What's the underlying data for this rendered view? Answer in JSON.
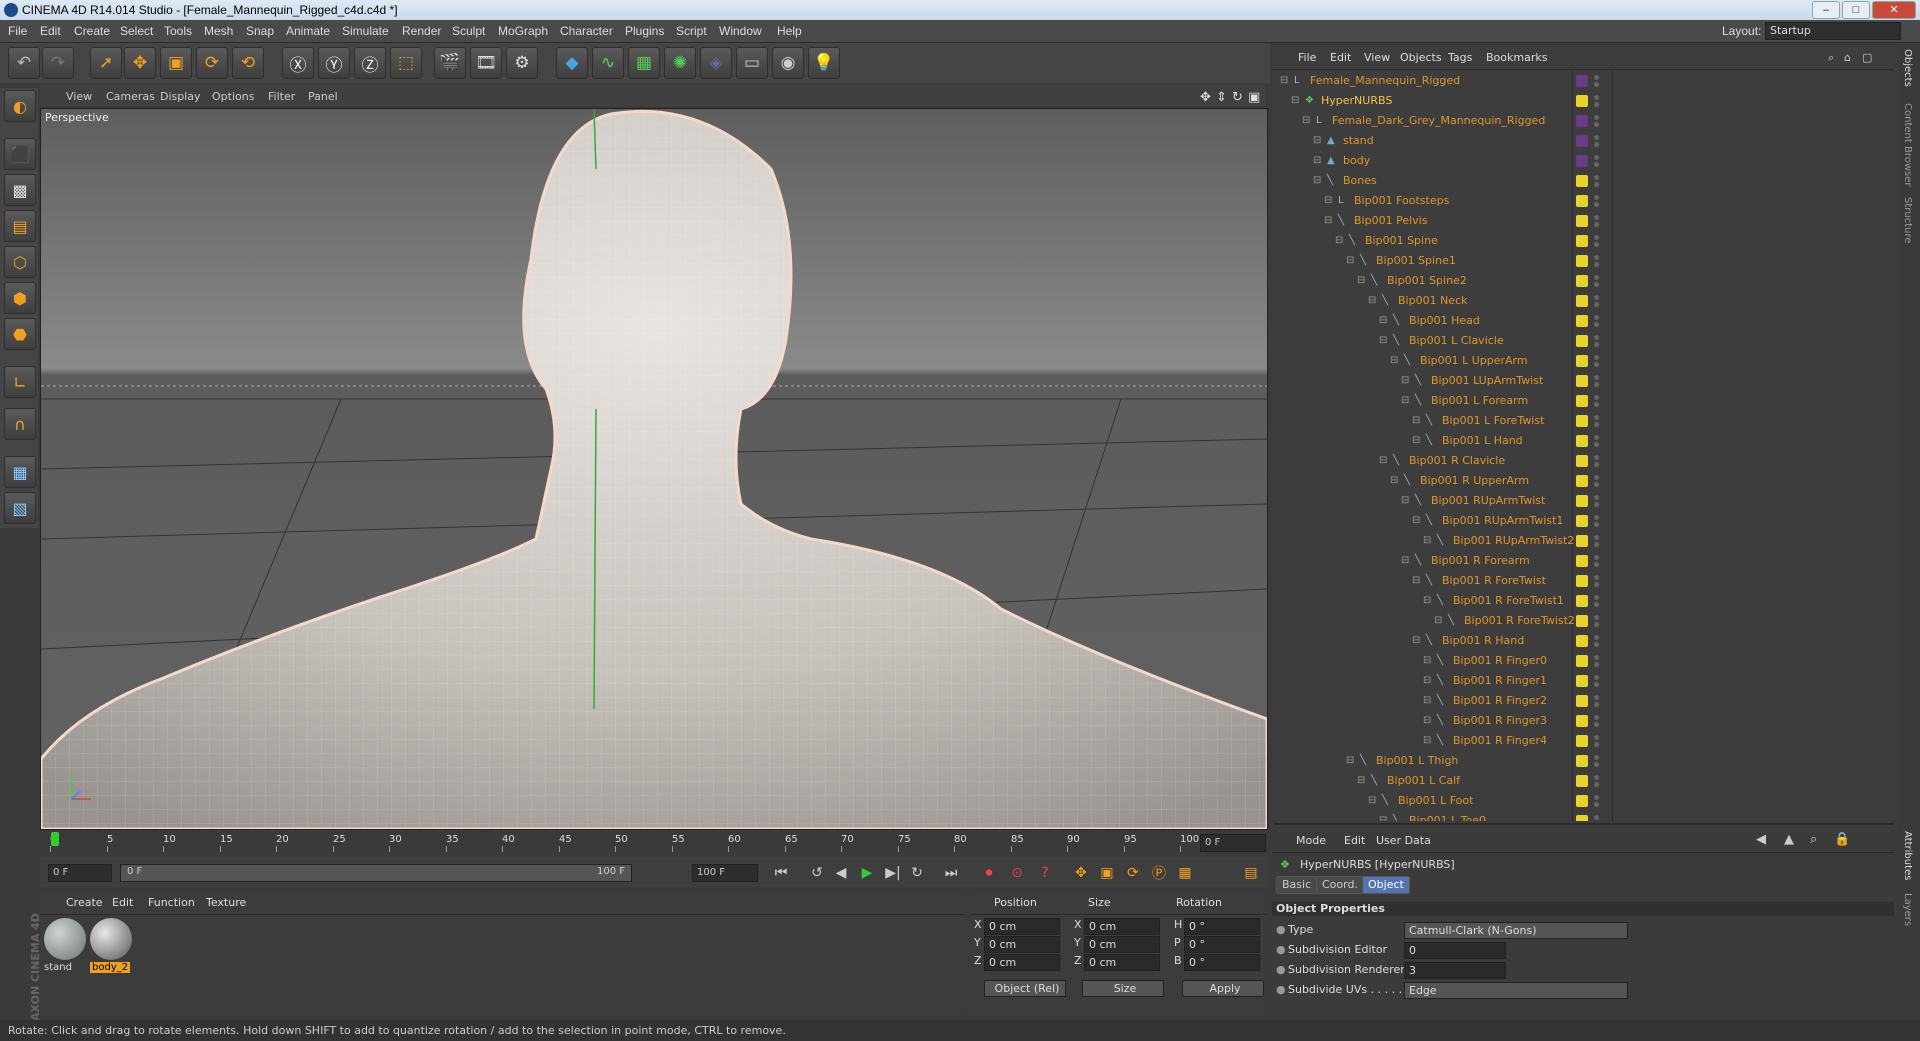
{
  "window": {
    "title": "CINEMA 4D R14.014 Studio - [Female_Mannequin_Rigged_c4d.c4d *]",
    "layout_label": "Layout:",
    "layout_value": "Startup"
  },
  "menubar": [
    "File",
    "Edit",
    "Create",
    "Select",
    "Tools",
    "Mesh",
    "Snap",
    "Animate",
    "Simulate",
    "Render",
    "Sculpt",
    "MoGraph",
    "Character",
    "Plugins",
    "Script",
    "Window",
    "Help"
  ],
  "viewport": {
    "menu": [
      "View",
      "Cameras",
      "Display",
      "Options",
      "Filter",
      "Panel"
    ],
    "label": "Perspective"
  },
  "timeline": {
    "ticks": [
      "0",
      "5",
      "10",
      "15",
      "20",
      "25",
      "30",
      "35",
      "40",
      "45",
      "50",
      "55",
      "60",
      "65",
      "70",
      "75",
      "80",
      "85",
      "90",
      "95",
      "100"
    ],
    "frame_display": "0 F"
  },
  "transport": {
    "start": "0 F",
    "range_start": "0 F",
    "range_end": "100 F",
    "end": "100 F"
  },
  "material_manager": {
    "menu": [
      "Create",
      "Edit",
      "Function",
      "Texture"
    ],
    "materials": [
      {
        "name": "stand",
        "selected": false
      },
      {
        "name": "body_2",
        "selected": true
      }
    ]
  },
  "coord_manager": {
    "headers": [
      "Position",
      "Size",
      "Rotation"
    ],
    "rows": [
      {
        "pos_label": "X",
        "pos": "0 cm",
        "size_label": "X",
        "size": "0 cm",
        "rot_label": "H",
        "rot": "0 °"
      },
      {
        "pos_label": "Y",
        "pos": "0 cm",
        "size_label": "Y",
        "size": "0 cm",
        "rot_label": "P",
        "rot": "0 °"
      },
      {
        "pos_label": "Z",
        "pos": "0 cm",
        "size_label": "Z",
        "size": "0 cm",
        "rot_label": "B",
        "rot": "0 °"
      }
    ],
    "mode": "Object (Rel)",
    "size_mode": "Size",
    "apply": "Apply"
  },
  "object_manager": {
    "menu": [
      "File",
      "Edit",
      "View",
      "Objects",
      "Tags",
      "Bookmarks"
    ],
    "objects": [
      {
        "name": "Female_Mannequin_Rigged",
        "depth": 0,
        "icon": "null"
      },
      {
        "name": "HyperNURBS",
        "depth": 1,
        "icon": "nurbs"
      },
      {
        "name": "Female_Dark_Grey_Mannequin_Rigged",
        "depth": 2,
        "icon": "null"
      },
      {
        "name": "stand",
        "depth": 3,
        "icon": "mesh"
      },
      {
        "name": "body",
        "depth": 3,
        "icon": "mesh"
      },
      {
        "name": "Bones",
        "depth": 3,
        "icon": "bone"
      },
      {
        "name": "Bip001 Footsteps",
        "depth": 4,
        "icon": "null"
      },
      {
        "name": "Bip001 Pelvis",
        "depth": 4,
        "icon": "bone"
      },
      {
        "name": "Bip001 Spine",
        "depth": 5,
        "icon": "bone"
      },
      {
        "name": "Bip001 Spine1",
        "depth": 6,
        "icon": "bone"
      },
      {
        "name": "Bip001 Spine2",
        "depth": 7,
        "icon": "bone"
      },
      {
        "name": "Bip001 Neck",
        "depth": 8,
        "icon": "bone"
      },
      {
        "name": "Bip001 Head",
        "depth": 9,
        "icon": "bone"
      },
      {
        "name": "Bip001 L Clavicle",
        "depth": 9,
        "icon": "bone"
      },
      {
        "name": "Bip001 L UpperArm",
        "depth": 10,
        "icon": "bone"
      },
      {
        "name": "Bip001 LUpArmTwist",
        "depth": 11,
        "icon": "bone"
      },
      {
        "name": "Bip001 L Forearm",
        "depth": 11,
        "icon": "bone"
      },
      {
        "name": "Bip001 L ForeTwist",
        "depth": 12,
        "icon": "bone"
      },
      {
        "name": "Bip001 L Hand",
        "depth": 12,
        "icon": "bone"
      },
      {
        "name": "Bip001 R Clavicle",
        "depth": 9,
        "icon": "bone"
      },
      {
        "name": "Bip001 R UpperArm",
        "depth": 10,
        "icon": "bone"
      },
      {
        "name": "Bip001 RUpArmTwist",
        "depth": 11,
        "icon": "bone"
      },
      {
        "name": "Bip001 RUpArmTwist1",
        "depth": 12,
        "icon": "bone"
      },
      {
        "name": "Bip001 RUpArmTwist2",
        "depth": 13,
        "icon": "bone"
      },
      {
        "name": "Bip001 R Forearm",
        "depth": 11,
        "icon": "bone"
      },
      {
        "name": "Bip001 R ForeTwist",
        "depth": 12,
        "icon": "bone"
      },
      {
        "name": "Bip001 R ForeTwist1",
        "depth": 13,
        "icon": "bone"
      },
      {
        "name": "Bip001 R ForeTwist2",
        "depth": 14,
        "icon": "bone"
      },
      {
        "name": "Bip001 R Hand",
        "depth": 12,
        "icon": "bone"
      },
      {
        "name": "Bip001 R Finger0",
        "depth": 13,
        "icon": "bone"
      },
      {
        "name": "Bip001 R Finger1",
        "depth": 13,
        "icon": "bone"
      },
      {
        "name": "Bip001 R Finger2",
        "depth": 13,
        "icon": "bone"
      },
      {
        "name": "Bip001 R Finger3",
        "depth": 13,
        "icon": "bone"
      },
      {
        "name": "Bip001 R Finger4",
        "depth": 13,
        "icon": "bone"
      },
      {
        "name": "Bip001 L Thigh",
        "depth": 6,
        "icon": "bone"
      },
      {
        "name": "Bip001 L Calf",
        "depth": 7,
        "icon": "bone"
      },
      {
        "name": "Bip001 L Foot",
        "depth": 8,
        "icon": "bone"
      },
      {
        "name": "Bip001 L Toe0",
        "depth": 9,
        "icon": "bone"
      }
    ]
  },
  "attributes": {
    "menu": [
      "Mode",
      "Edit",
      "User Data"
    ],
    "object_title": "HyperNURBS [HyperNURBS]",
    "tabs": [
      "Basic",
      "Coord.",
      "Object"
    ],
    "active_tab": "Object",
    "section": "Object Properties",
    "props": [
      {
        "label": "Type",
        "value": "Catmull-Clark (N-Gons)",
        "kind": "dropdown"
      },
      {
        "label": "Subdivision Editor",
        "value": "0",
        "kind": "number"
      },
      {
        "label": "Subdivision Renderer",
        "value": "3",
        "kind": "number"
      },
      {
        "label": "Subdivide UVs . . . . . .",
        "value": "Edge",
        "kind": "dropdown"
      }
    ]
  },
  "status": "Rotate: Click and drag to rotate elements. Hold down SHIFT to add to quantize rotation / add to the selection in point mode, CTRL to remove.",
  "side_tabs": [
    "Objects",
    "Content Browser",
    "Structure",
    "Attributes",
    "Layers"
  ],
  "branding": "MAXON CINEMA 4D",
  "colors": {
    "accent": "#f0a020",
    "object_text": "#e0962a",
    "tag_yellow": "#e8d32c",
    "viewport_bg": "#6b6b6b"
  }
}
